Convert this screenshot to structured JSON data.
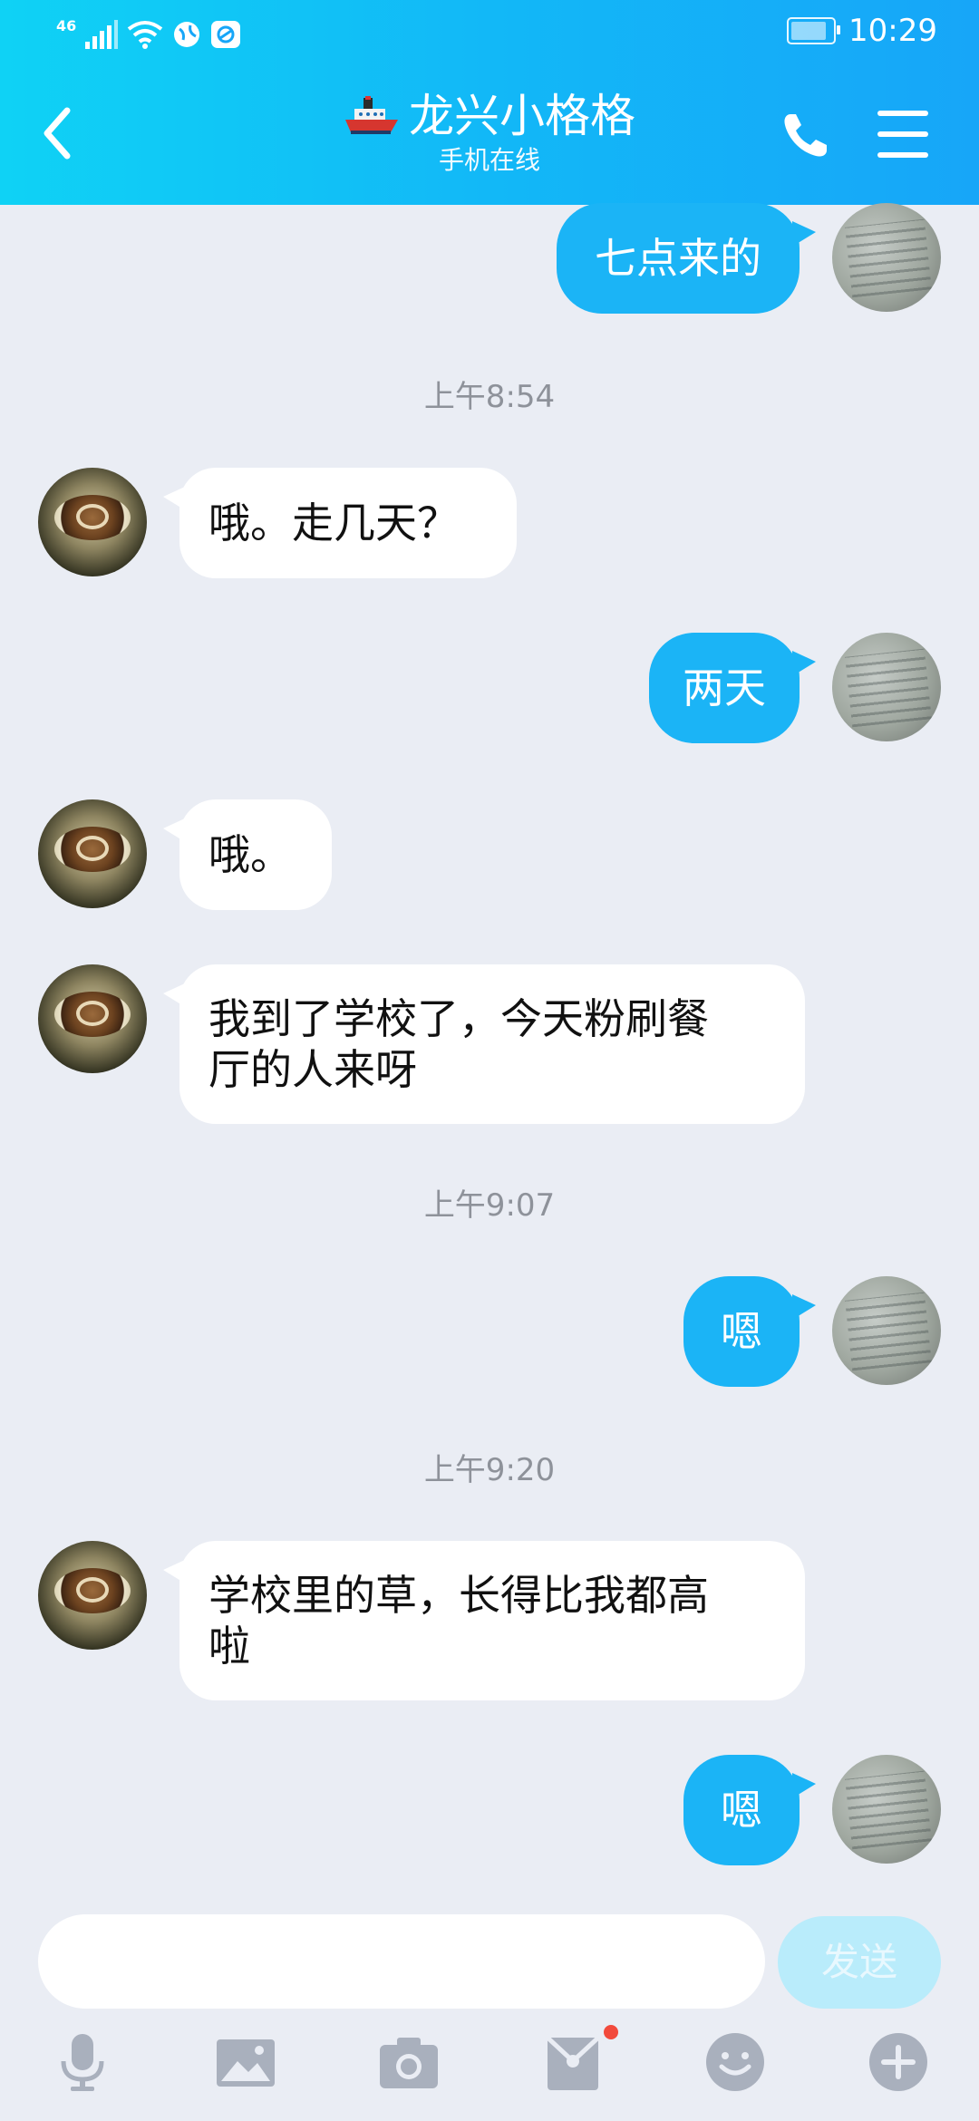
{
  "status_bar": {
    "network": "46",
    "time": "10:29"
  },
  "header": {
    "contact_name": "龙兴小格格",
    "contact_status": "手机在线"
  },
  "messages": [
    {
      "sender": "me",
      "text": "七点来的"
    },
    {
      "type": "time",
      "text": "上午8:54"
    },
    {
      "sender": "other",
      "text": "哦。走几天？"
    },
    {
      "sender": "me",
      "text": "两天"
    },
    {
      "sender": "other",
      "text": "哦。"
    },
    {
      "sender": "other",
      "lines": [
        "我到了学校了，今天粉刷餐",
        "厅的人来呀"
      ]
    },
    {
      "type": "time",
      "text": "上午9:07"
    },
    {
      "sender": "me",
      "text": "嗯"
    },
    {
      "type": "time",
      "text": "上午9:20"
    },
    {
      "sender": "other",
      "lines": [
        "学校里的草，长得比我都高",
        "啦"
      ]
    },
    {
      "sender": "me",
      "text": "嗯"
    }
  ],
  "input": {
    "value": "",
    "placeholder": "",
    "send_label": "发送"
  },
  "toolbar": [
    "microphone-icon",
    "image-icon",
    "camera-icon",
    "red-packet-icon",
    "emoji-icon",
    "plus-icon"
  ],
  "colors": {
    "header_start": "#0fd2f5",
    "header_end": "#17a6f8",
    "my_bubble": "#1bb4f6",
    "background": "#eaedf4",
    "send_button": "#b9ecfb"
  }
}
